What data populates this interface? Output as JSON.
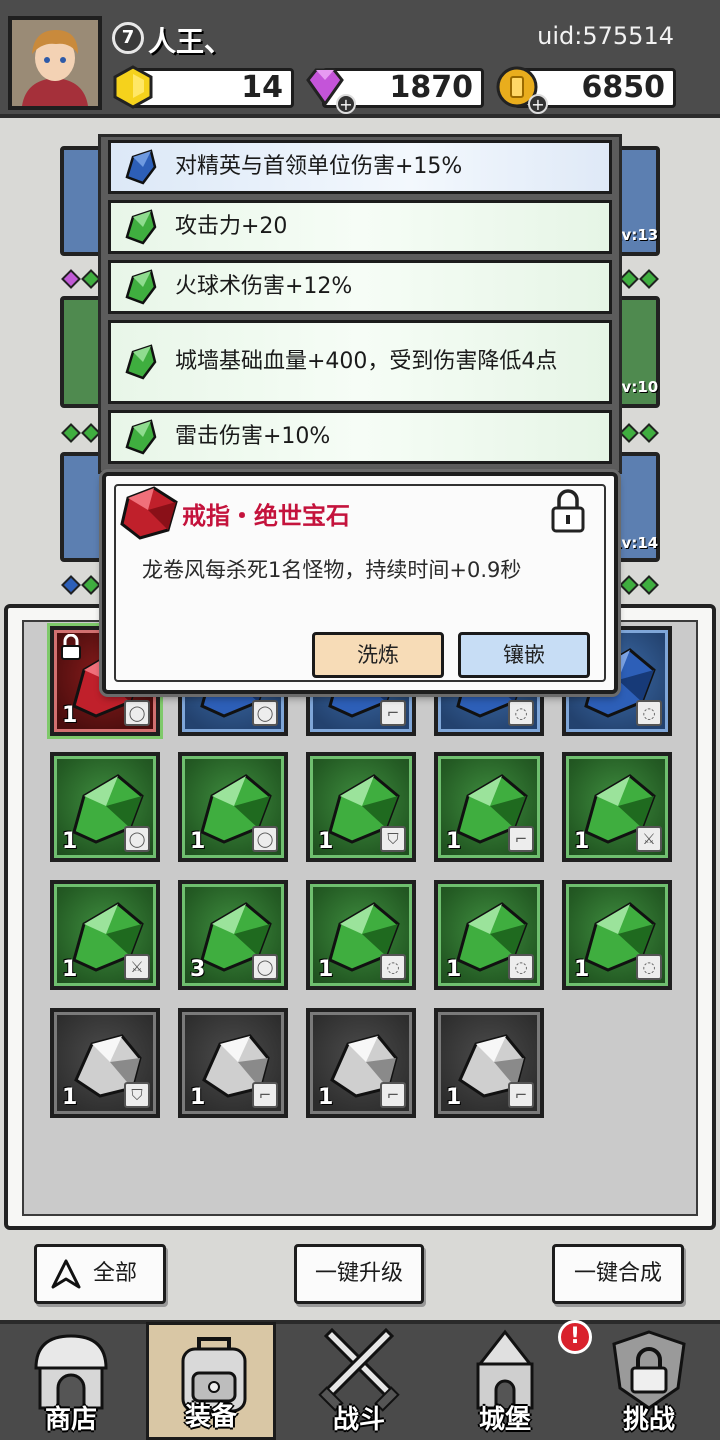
{
  "header": {
    "level": "7",
    "player_name": "人王、",
    "uid": "uid:575514",
    "gold_gem_count": "14",
    "diamond_count": "1870",
    "coin_count": "6850"
  },
  "equipment_levels": [
    "Lv:13",
    "Lv:10",
    "Lv:14"
  ],
  "stats": [
    {
      "text": "对精英与首领单位伤害+15%",
      "gem": "blue"
    },
    {
      "text": "攻击力+20",
      "gem": "green"
    },
    {
      "text": "火球术伤害+12%",
      "gem": "green"
    },
    {
      "text": "城墙基础血量+400，受到伤害降低4点",
      "gem": "green"
    },
    {
      "text": "雷击伤害+10%",
      "gem": "green"
    }
  ],
  "gem_popup": {
    "title": "戒指・绝世宝石",
    "description": "龙卷风每杀死1名怪物，持续时间+0.9秒",
    "refine_label": "洗炼",
    "inlay_label": "镶嵌",
    "locked": true
  },
  "inventory": {
    "rows": [
      [
        {
          "color": "red",
          "count": "1",
          "slot": "ring",
          "locked": true
        },
        {
          "color": "blue",
          "count": "",
          "slot": "ring"
        },
        {
          "color": "blue",
          "count": "",
          "slot": "boot"
        },
        {
          "color": "blue",
          "count": "",
          "slot": "necklace"
        },
        {
          "color": "blue",
          "count": "",
          "slot": "necklace"
        }
      ],
      [
        {
          "color": "green",
          "count": "1",
          "slot": "ring"
        },
        {
          "color": "green",
          "count": "1",
          "slot": "ring"
        },
        {
          "color": "green",
          "count": "1",
          "slot": "armor"
        },
        {
          "color": "green",
          "count": "1",
          "slot": "boot"
        },
        {
          "color": "green",
          "count": "1",
          "slot": "weapon"
        }
      ],
      [
        {
          "color": "green",
          "count": "1",
          "slot": "weapon"
        },
        {
          "color": "green",
          "count": "3",
          "slot": "ring"
        },
        {
          "color": "green",
          "count": "1",
          "slot": "necklace"
        },
        {
          "color": "green",
          "count": "1",
          "slot": "necklace"
        },
        {
          "color": "green",
          "count": "1",
          "slot": "necklace"
        }
      ],
      [
        {
          "color": "gray",
          "count": "1",
          "slot": "armor"
        },
        {
          "color": "gray",
          "count": "1",
          "slot": "boot"
        },
        {
          "color": "gray",
          "count": "1",
          "slot": "boot"
        },
        {
          "color": "gray",
          "count": "1",
          "slot": "boot"
        }
      ]
    ]
  },
  "actions": {
    "filter_label": "全部",
    "upgrade_all_label": "一键升级",
    "merge_all_label": "一键合成"
  },
  "nav": [
    {
      "label": "商店",
      "active": false
    },
    {
      "label": "装备",
      "active": true
    },
    {
      "label": "战斗",
      "active": false
    },
    {
      "label": "城堡",
      "active": false
    },
    {
      "label": "挑战",
      "active": false
    }
  ],
  "nav_badge": "!",
  "colors": {
    "green_gem": "#3fae3f",
    "blue_gem": "#2d5fb8",
    "red_gem": "#c0202b",
    "gray_gem": "#d0d0d0",
    "title_red": "#c4133c",
    "refine_btn": "#f7dcb7",
    "inlay_btn": "#c7ddf5"
  }
}
